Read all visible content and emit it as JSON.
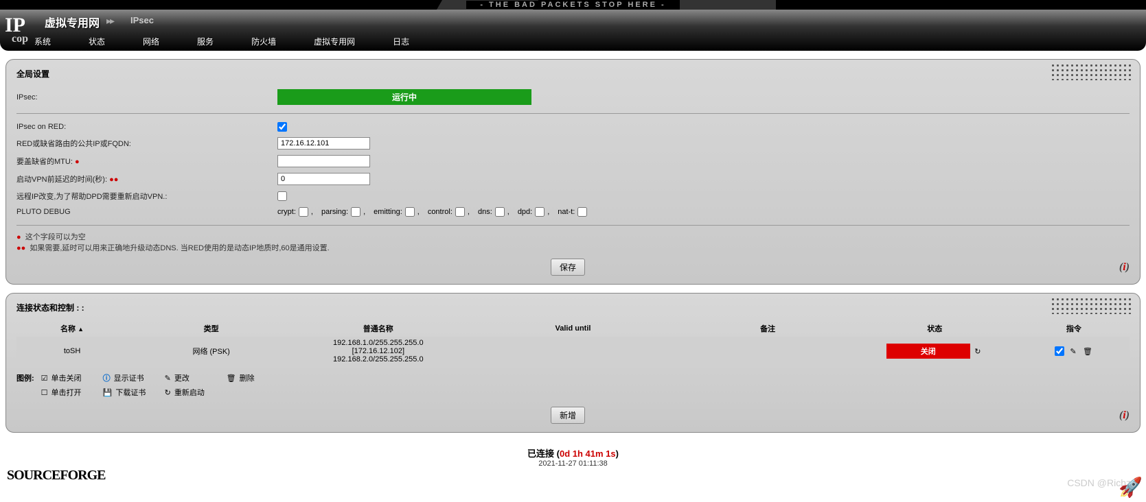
{
  "banner": "- THE BAD PACKETS STOP HERE -",
  "header": {
    "title": "虚拟专用网",
    "sep": "▸▸",
    "page": "IPsec"
  },
  "nav": [
    "系统",
    "状态",
    "网络",
    "服务",
    "防火墙",
    "虚拟专用网",
    "日志"
  ],
  "global": {
    "title": "全局设置",
    "ipsec_label": "IPsec:",
    "running": "运行中",
    "onred_label": "IPsec on RED:",
    "fqdn_label": "RED或缺省路由的公共IP或FQDN:",
    "fqdn_value": "172.16.12.101",
    "mtu_label": "要盖缺省的MTU:",
    "mtu_value": "",
    "delay_label": "启动VPN前延迟的时间(秒):",
    "delay_value": "0",
    "restart_label": "远程IP改变,为了帮助DPD需要重新启动VPN.:",
    "pluto_label": "PLUTO DEBUG",
    "debug": {
      "crypt": "crypt:",
      "parsing": "parsing:",
      "emitting": "emitting:",
      "control": "control:",
      "dns": "dns:",
      "dpd": "dpd:",
      "natt": "nat-t:"
    },
    "note1": "这个字段可以为空",
    "note2": "如果需要,延时可以用来正确地升级动态DNS. 当RED使用的是动态IP地质时,60是通用设置.",
    "save": "保存"
  },
  "conn": {
    "title": "连接状态和控制 : :",
    "headers": {
      "name": "名称",
      "type": "类型",
      "common": "普通名称",
      "valid": "Valid until",
      "remark": "备注",
      "status": "状态",
      "cmd": "指令"
    },
    "row": {
      "name": "toSH",
      "type": "网络 (PSK)",
      "c1": "192.168.1.0/255.255.255.0",
      "c2": "[172.16.12.102]",
      "c3": "192.168.2.0/255.255.255.0",
      "status": "关闭"
    },
    "legend_label": "图例:",
    "legend": {
      "click_close": "单击关闭",
      "show_cert": "显示证书",
      "edit": "更改",
      "delete": "删除",
      "click_open": "单击打开",
      "dl_cert": "下载证书",
      "restart": "重新启动"
    },
    "add": "新增"
  },
  "footer": {
    "connected": "已连接 (",
    "uptime": "0d 1h 41m 1s",
    "close": ")",
    "ts": "2021-11-27 01:11:38",
    "sf": "SOURCEFORGE",
    "wm": "CSDN @Richzc"
  }
}
